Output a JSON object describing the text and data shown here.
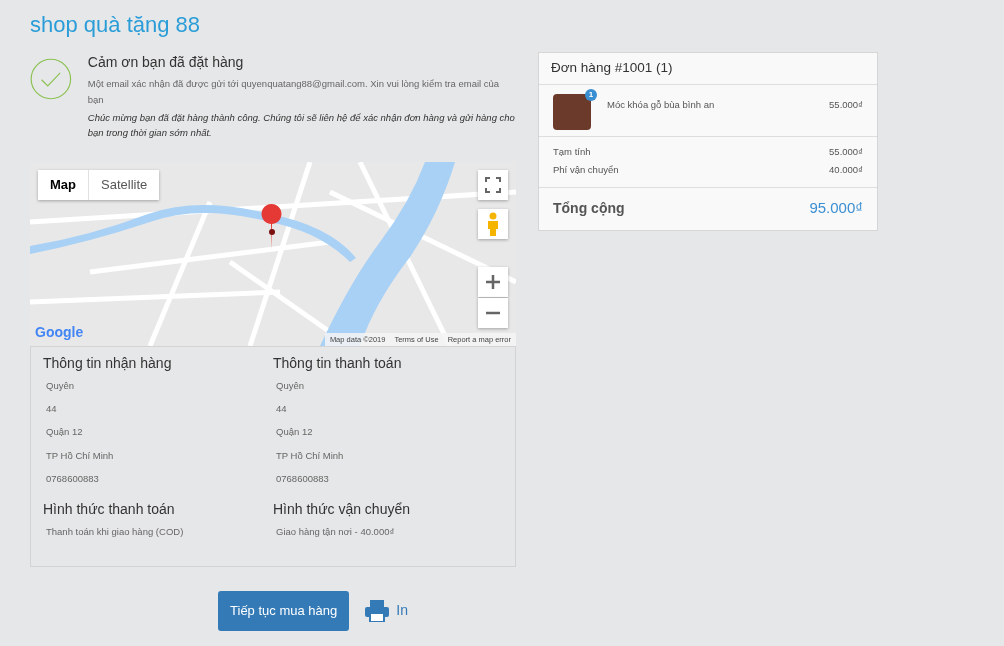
{
  "shop_name": "shop quà tặng 88",
  "thank_you": {
    "title": "Cảm ơn bạn đã đặt hàng",
    "email_note": "Một email xác nhận đã được gửi tới quyenquatang88@gmail.com. Xin vui lòng kiểm tra email của bạn",
    "congrats": "Chúc mừng bạn đã đặt hàng thành công. Chúng tôi sẽ liên hệ để xác nhận đơn hàng và gửi hàng cho bạn trong thời gian sớm nhất."
  },
  "map": {
    "tabs": [
      {
        "label": "Map",
        "selected": true
      },
      {
        "label": "Satellite",
        "selected": false
      }
    ],
    "logo": "Google",
    "footer": [
      "Map data ©2019",
      "Terms of Use",
      "Report a map error"
    ]
  },
  "info_sections": [
    {
      "heading": "Thông tin nhận hàng",
      "lines": [
        "Quyên",
        "44",
        "Quận 12",
        "TP Hồ Chí Minh",
        "0768600883"
      ]
    },
    {
      "heading": "Thông tin thanh toán",
      "lines": [
        "Quyên",
        "44",
        "Quận 12",
        "TP Hồ Chí Minh",
        "0768600883"
      ]
    },
    {
      "heading": "Hình thức thanh toán",
      "lines": [
        "Thanh toán khi giao hàng (COD)"
      ]
    },
    {
      "heading": "Hình thức vận chuyển",
      "lines": [
        "Giao hàng tận nơi - 40.000₫"
      ]
    }
  ],
  "actions": {
    "continue": "Tiếp tục mua hàng",
    "print": "In"
  },
  "order": {
    "title": "Đơn hàng #1001 (1)",
    "items": [
      {
        "name": "Móc khóa gỗ bùa bình an",
        "quantity": "1",
        "price": "55.000₫"
      }
    ],
    "subtotals": [
      {
        "label": "Tạm tính",
        "value": "55.000₫"
      },
      {
        "label": "Phí vận chuyển",
        "value": "40.000₫"
      }
    ],
    "total": {
      "label": "Tổng cộng",
      "value": "95.000₫"
    }
  }
}
